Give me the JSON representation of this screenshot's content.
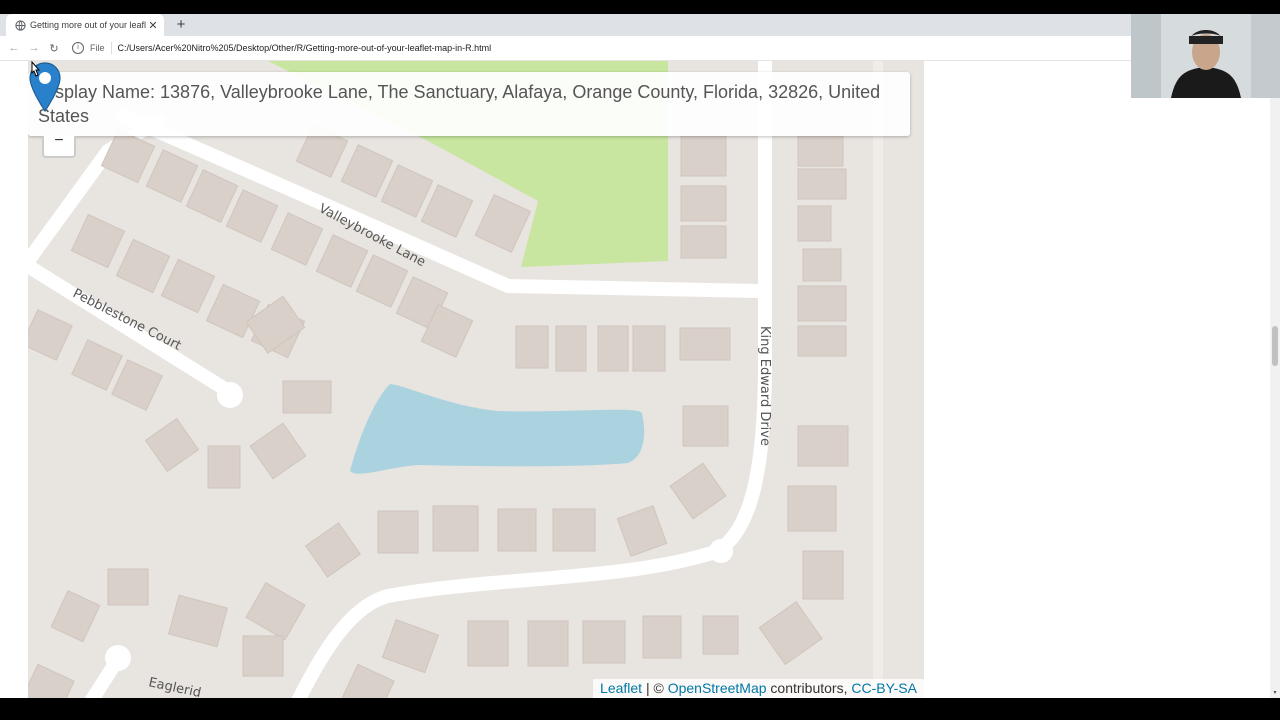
{
  "browser": {
    "tab_title": "Getting more out of your leaflet",
    "close_symbol": "✕",
    "new_tab_symbol": "+",
    "back_symbol": "←",
    "forward_symbol": "→",
    "reload_symbol": "↻",
    "info_symbol": "i",
    "file_label": "File",
    "url": "C:/Users/Acer%20Nitro%205/Desktop/Other/R/Getting-more-out-of-your-leaflet-map-in-R.html"
  },
  "map": {
    "popup_text": "Display Name: 13876, Valleybrooke Lane, The Sanctuary, Alafaya, Orange County, Florida, 32826, United States",
    "zoom_out_symbol": "−",
    "street_labels": {
      "valleybrooke": "Valleybrooke Lane",
      "pebblestone": "Pebblestone Court",
      "king_edward": "King Edward Drive",
      "eagleridge": "Eaglerid"
    },
    "attribution": {
      "leaflet": "Leaflet",
      "separator": " | © ",
      "osm": "OpenStreetMap",
      "contributors": " contributors, ",
      "license": "CC-BY-SA"
    },
    "colors": {
      "land": "#e8e4e0",
      "building": "#d9d0c9",
      "road": "#ffffff",
      "park": "#c8e6a0",
      "water": "#aad3df",
      "marker": "#2a81cb"
    }
  },
  "scrollbar": {
    "arrow": "▾"
  }
}
